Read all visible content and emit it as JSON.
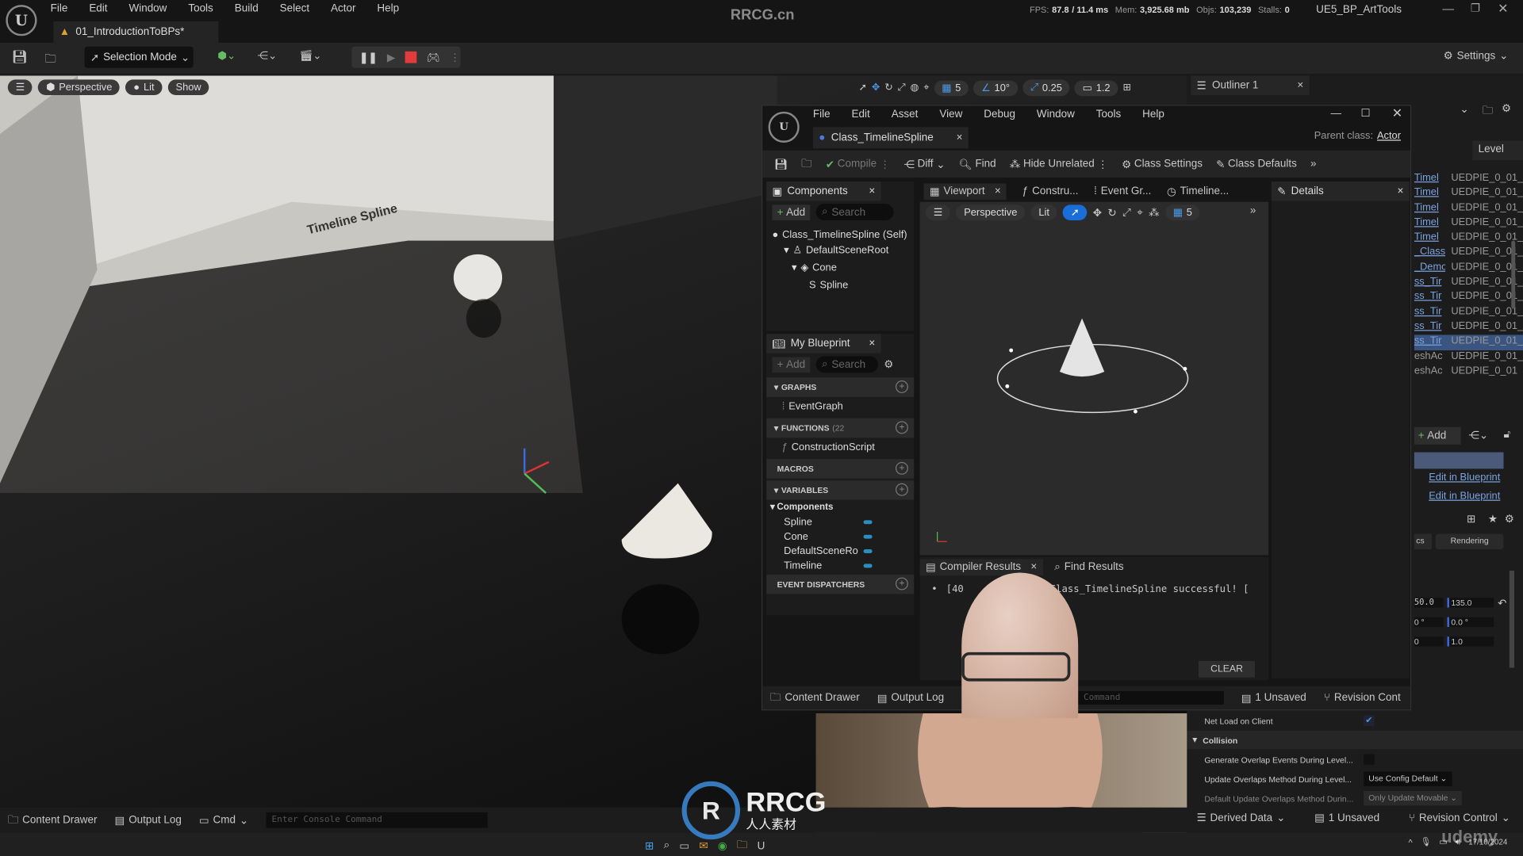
{
  "app": {
    "menu": [
      "File",
      "Edit",
      "Window",
      "Tools",
      "Build",
      "Select",
      "Actor",
      "Help"
    ],
    "level_tab": "01_IntroductionToBPs*",
    "watermark": "RRCG.cn",
    "stats": {
      "fps_label": "FPS:",
      "fps": "87.8",
      "ms": "/ 11.4 ms",
      "mem_label": "Mem:",
      "mem": "3,925.68 mb",
      "objs_label": "Objs:",
      "objs": "103,239",
      "stalls_label": "Stalls:",
      "stalls": "0"
    },
    "project": "UE5_BP_ArtTools",
    "settings_label": "Settings"
  },
  "toolbar": {
    "selection_mode": "Selection Mode",
    "stop_color": "#e23b3b"
  },
  "viewport": {
    "perspective": "Perspective",
    "lit": "Lit",
    "show": "Show",
    "sign_text": "Timeline Spline",
    "snap": {
      "grid": "5",
      "angle": "10°",
      "scale": "0.25",
      "camera": "1.2"
    }
  },
  "outliner": {
    "tab": "Outliner 1",
    "column_level": "Level",
    "rows": [
      {
        "name": "Timel",
        "level": "UEDPIE_0_01_"
      },
      {
        "name": "Timel",
        "level": "UEDPIE_0_01_"
      },
      {
        "name": "Timel",
        "level": "UEDPIE_0_01_"
      },
      {
        "name": "Timel",
        "level": "UEDPIE_0_01_"
      },
      {
        "name": "Timel",
        "level": "UEDPIE_0_01_"
      },
      {
        "name": "_Class",
        "level": "UEDPIE_0_01_"
      },
      {
        "name": "_Demc",
        "level": "UEDPIE_0_01_"
      },
      {
        "name": "ss_Tir",
        "level": "UEDPIE_0_01_"
      },
      {
        "name": "ss_Tir",
        "level": "UEDPIE_0_01_"
      },
      {
        "name": "ss_Tir",
        "level": "UEDPIE_0_01_"
      },
      {
        "name": "ss_Tir",
        "level": "UEDPIE_0_01_"
      },
      {
        "name": "ss_Tir",
        "level": "UEDPIE_0_01_"
      },
      {
        "name": "eshAc",
        "level": "UEDPIE_0_01_"
      },
      {
        "name": "eshAc",
        "level": "UEDPIE_0_01"
      }
    ]
  },
  "details_right": {
    "add": "Add",
    "edit1": "Edit in Blueprint",
    "edit2": "Edit in Blueprint",
    "tab_partial": "cs",
    "tab_rendering": "Rendering",
    "vals": [
      [
        "50.0",
        "135.0"
      ],
      [
        "0 °",
        "0.0 °"
      ],
      [
        "0",
        "1.0"
      ]
    ],
    "net_load": "Net Load on Client",
    "collision": "Collision",
    "gen_overlap": "Generate Overlap Events During Level...",
    "update_overlaps": "Update Overlaps Method During Level...",
    "update_overlaps_value": "Use Config Default",
    "default_update": "Default Update Overlaps Method Durin...",
    "default_update_value": "Only Update Movable"
  },
  "bp": {
    "menu": [
      "File",
      "Edit",
      "Asset",
      "View",
      "Debug",
      "Window",
      "Tools",
      "Help"
    ],
    "tab": "Class_TimelineSpline",
    "parent_label": "Parent class:",
    "parent_value": "Actor",
    "toolbar": {
      "compile": "Compile",
      "diff": "Diff",
      "find": "Find",
      "hide_unrelated": "Hide Unrelated",
      "class_settings": "Class Settings",
      "class_defaults": "Class Defaults"
    },
    "components": {
      "title": "Components",
      "add": "Add",
      "search": "Search",
      "tree": [
        "Class_TimelineSpline (Self)",
        "DefaultSceneRoot",
        "Cone",
        "Spline"
      ]
    },
    "my_blueprint": {
      "title": "My Blueprint",
      "add": "Add",
      "search": "Search",
      "graphs": "GRAPHS",
      "event_graph": "EventGraph",
      "functions": "FUNCTIONS",
      "functions_count": "(22",
      "construction": "ConstructionScript",
      "macros": "MACROS",
      "variables": "VARIABLES",
      "components": "Components",
      "vars": [
        "Spline",
        "Cone",
        "DefaultSceneRo",
        "Timeline"
      ],
      "dispatchers": "EVENT DISPATCHERS",
      "var_color": "#2a8fbf"
    },
    "tabs": [
      "Viewport",
      "Constru...",
      "Event Gr...",
      "Timeline..."
    ],
    "details_tab": "Details",
    "vp": {
      "perspective": "Perspective",
      "lit": "Lit",
      "grid": "5"
    },
    "compiler": {
      "tab": "Compiler Results",
      "find_tab": "Find Results",
      "log_prefix": "[40",
      "log": "Class_TimelineSpline successful! [",
      "clear": "CLEAR"
    },
    "bottom": {
      "content_drawer": "Content Drawer",
      "output_log": "Output Log",
      "console_placeholder": "ole Command",
      "unsaved": "1 Unsaved",
      "revision": "Revision Cont"
    }
  },
  "statusbar": {
    "content_drawer": "Content Drawer",
    "output_log": "Output Log",
    "cmd": "Cmd",
    "console_placeholder": "Enter Console Command",
    "derived_data": "Derived Data",
    "unsaved": "1 Unsaved",
    "revision": "Revision Control"
  },
  "taskbar": {
    "date": "17/10/2024",
    "udemy": "udemy"
  },
  "overlay_logo": {
    "text": "RRCG",
    "sub": "人人素材"
  }
}
